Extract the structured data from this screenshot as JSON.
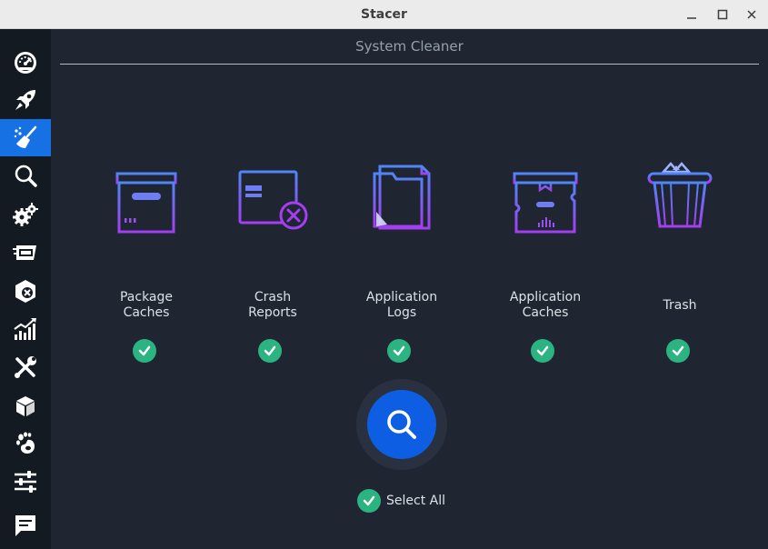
{
  "window": {
    "title": "Stacer"
  },
  "page": {
    "title": "System Cleaner"
  },
  "sidebar": {
    "items": [
      {
        "name": "dashboard",
        "icon": "speedometer-icon",
        "active": false
      },
      {
        "name": "startup-apps",
        "icon": "rocket-icon",
        "active": false
      },
      {
        "name": "system-cleaner",
        "icon": "broom-icon",
        "active": true
      },
      {
        "name": "search",
        "icon": "search-icon",
        "active": false
      },
      {
        "name": "services",
        "icon": "gears-icon",
        "active": false
      },
      {
        "name": "processes",
        "icon": "processes-icon",
        "active": false
      },
      {
        "name": "uninstaller",
        "icon": "package-icon",
        "active": false
      },
      {
        "name": "resources",
        "icon": "chart-icon",
        "active": false
      },
      {
        "name": "helpers",
        "icon": "tools-icon",
        "active": false
      },
      {
        "name": "apt-repository",
        "icon": "box-icon",
        "active": false
      },
      {
        "name": "gnome-settings",
        "icon": "gnome-foot-icon",
        "active": false
      },
      {
        "name": "settings",
        "icon": "sliders-icon",
        "active": false
      },
      {
        "name": "feedback",
        "icon": "chat-icon",
        "active": false
      }
    ]
  },
  "categories": [
    {
      "label": "Package\nCaches",
      "icon": "package-caches-icon",
      "checked": true
    },
    {
      "label": "Crash\nReports",
      "icon": "crash-reports-icon",
      "checked": true
    },
    {
      "label": "Application\nLogs",
      "icon": "application-logs-icon",
      "checked": true
    },
    {
      "label": "Application\nCaches",
      "icon": "application-caches-icon",
      "checked": true
    },
    {
      "label": "Trash",
      "icon": "trash-icon",
      "checked": true
    }
  ],
  "actions": {
    "scan_icon": "search-icon",
    "select_all_label": "Select All",
    "select_all_checked": true
  },
  "colors": {
    "sidebar_bg": "#141a21",
    "main_bg": "#1f2631",
    "accent": "#1571e4",
    "scan_button": "#0d5ee3",
    "check": "#2bb381",
    "icon_gradient_start": "#4f86f7",
    "icon_gradient_end": "#a43ef2"
  }
}
